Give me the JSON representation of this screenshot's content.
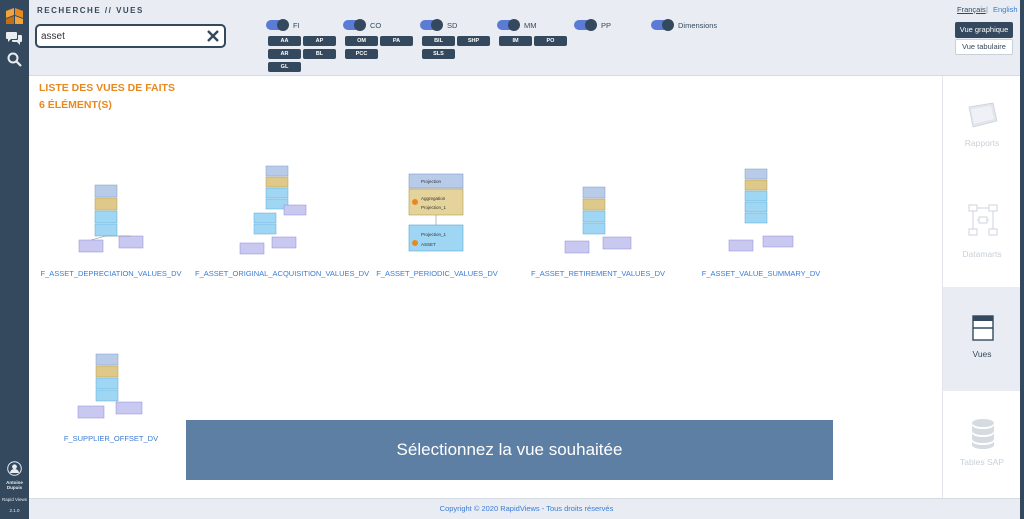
{
  "nav": {
    "user_name": "Antoine Dupuis",
    "product": "Rapid Views",
    "version": "2.1.0"
  },
  "header": {
    "breadcrumb": "RECHERCHE  //  VUES",
    "search_value": "asset",
    "lang_fr": "Français",
    "lang_sep": "|",
    "lang_en": "English",
    "btn_graph": "Vue graphique",
    "btn_table": "Vue tabulaire"
  },
  "filters": {
    "toggles": [
      "FI",
      "CO",
      "SD",
      "MM",
      "PP",
      "Dimensions"
    ],
    "chips": {
      "fi": [
        "AA",
        "AP",
        "AR",
        "BL",
        "GL"
      ],
      "co": [
        "OM",
        "PA",
        "PCC"
      ],
      "sd": [
        "BIL",
        "SHP",
        "SLS"
      ],
      "mm": [
        "IM",
        "PO"
      ]
    }
  },
  "main": {
    "title": "LISTE DES VUES DE FAITS",
    "count": "6 ÉLÉMENT(S)",
    "views": [
      "F_ASSET_DEPRECIATION_VALUES_DV",
      "F_ASSET_ORIGINAL_ACQUISITION_VALUES_DV",
      "F_ASSET_PERIODIC_VALUES_DV",
      "F_ASSET_RETIREMENT_VALUES_DV",
      "F_ASSET_VALUE_SUMMARY_DV",
      "F_SUPPLIER_OFFSET_DV"
    ],
    "diagram_text": {
      "projection": "Projection",
      "aggregation": "Aggregation",
      "projection_1": "Projection_1",
      "asset": "ASSET"
    },
    "overlay": "Sélectionnez la vue souhaitée"
  },
  "right_panel": {
    "items": [
      "Rapports",
      "Datamarts",
      "Vues",
      "Tables SAP"
    ],
    "active": "Vues"
  },
  "footer": {
    "copyright": "Copyright © 2020 RapidViews - Tous droits réservés"
  },
  "colors": {
    "nav_bg": "#34495e",
    "accent_orange": "#e8891f",
    "link_blue": "#3a7bd5",
    "overlay_bg": "#5c7fa3"
  }
}
